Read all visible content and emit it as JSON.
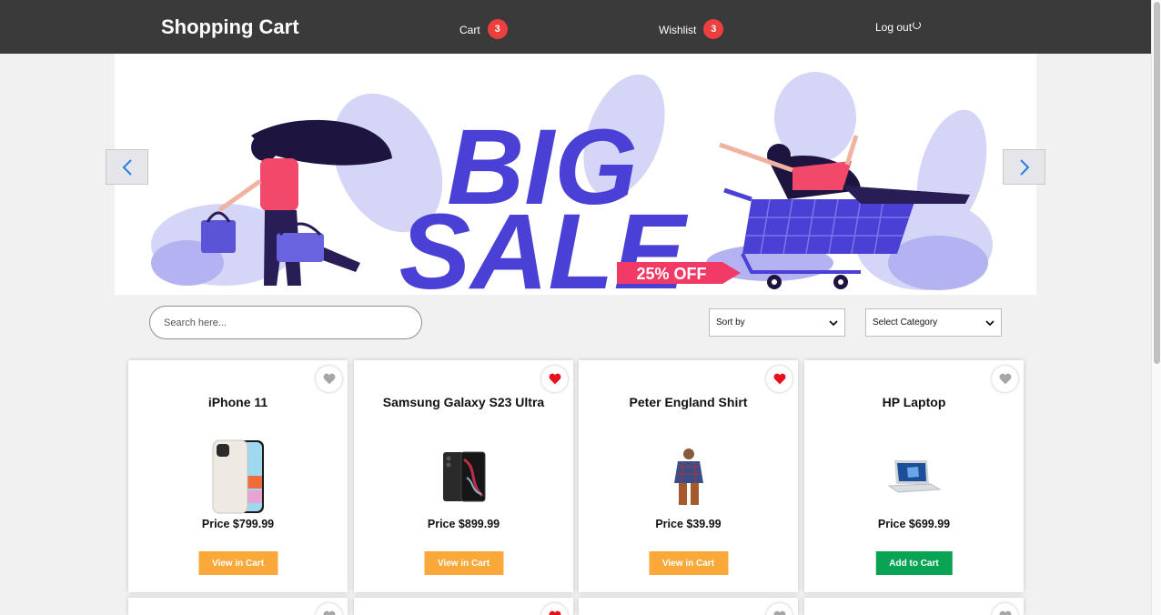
{
  "header": {
    "brand": "Shopping Cart",
    "cart_label": "Cart",
    "cart_count": "3",
    "wishlist_label": "Wishlist",
    "wishlist_count": "3",
    "logout_label": "Log out"
  },
  "banner": {
    "headline_line1": "BIG",
    "headline_line2": "SALE",
    "tag": "25% OFF"
  },
  "controls": {
    "search_placeholder": "Search here...",
    "sort_label": "Sort by",
    "category_label": "Select Category"
  },
  "products": [
    {
      "title": "iPhone 11",
      "price": "Price $799.99",
      "button": "View in Cart",
      "wishlisted": false
    },
    {
      "title": "Samsung Galaxy S23 Ultra",
      "price": "Price $899.99",
      "button": "View in Cart",
      "wishlisted": true
    },
    {
      "title": "Peter England Shirt",
      "price": "Price $39.99",
      "button": "View in Cart",
      "wishlisted": true
    },
    {
      "title": "HP Laptop",
      "price": "Price $699.99",
      "button": "Add to Cart",
      "wishlisted": false
    }
  ],
  "colors": {
    "header_bg": "#3a3a3a",
    "badge": "#ee3e3e",
    "view_button": "#f9a83a",
    "add_button": "#08a454",
    "heart_active": "#e8101c",
    "heart_inactive": "#a6a6a6"
  }
}
